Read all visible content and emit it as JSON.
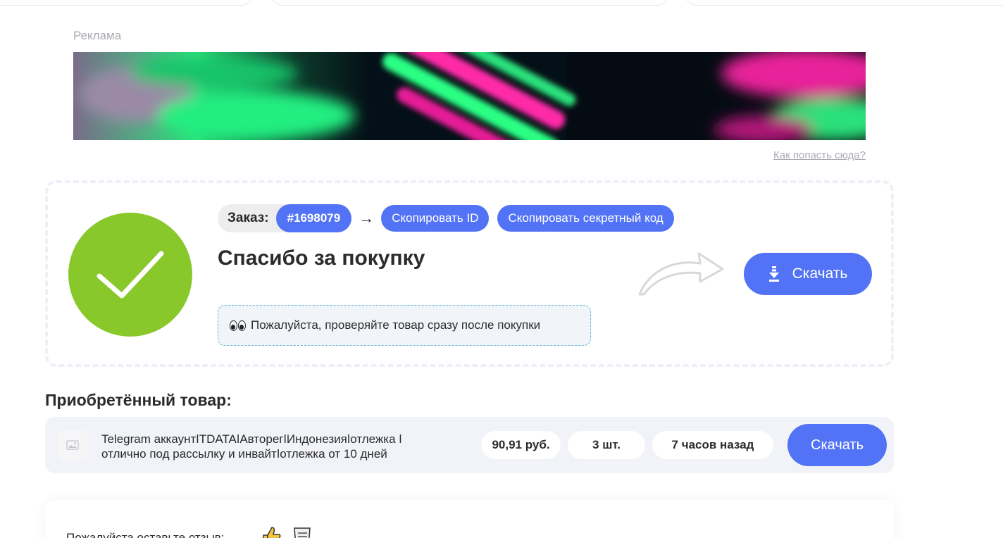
{
  "ad": {
    "label": "Реклама",
    "how_link": "Как попасть сюда?"
  },
  "order": {
    "label": "Заказ:",
    "id": "#1698079",
    "arrow": "→",
    "copy_id": "Скопировать ID",
    "copy_secret": "Скопировать секретный код",
    "thanks": "Спасибо за покупку",
    "notice": "Пожалуйста, проверяйте товар сразу после покупки",
    "download": "Скачать"
  },
  "purchased": {
    "title": "Приобретённый товар:",
    "item": {
      "name": "Telegram аккаунтǀTDATAǀАвторегǀИндонезияǀотлежка ǀ отлично под рассылку и инвайтǀотлежка от 10 дней",
      "price": "90,91 руб.",
      "quantity": "3 шт.",
      "time": "7 часов назад",
      "download": "Скачать"
    }
  },
  "review": {
    "prompt": "Пожалуйста оставьте отзыв:"
  },
  "colors": {
    "accent": "#5273f5",
    "success": "#89c82b",
    "card_bg": "#f1f3f8"
  }
}
